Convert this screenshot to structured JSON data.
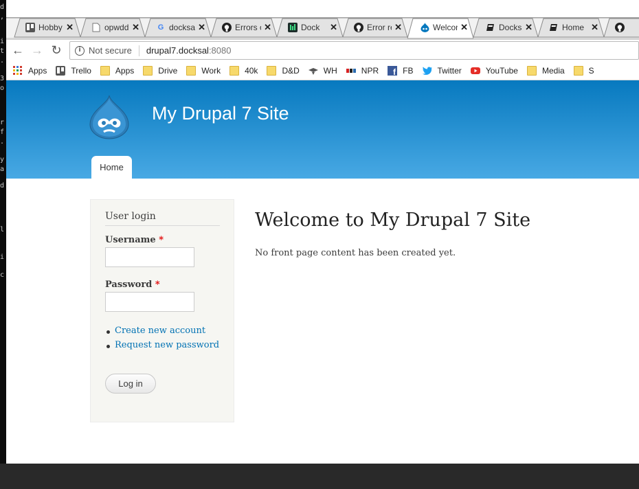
{
  "terminal_strip": [
    "d",
    ",",
    "i",
    "t",
    ".",
    "3",
    "o",
    "r",
    "f",
    ".",
    "y",
    "a",
    "d",
    "l",
    "i",
    "c"
  ],
  "tabs": [
    {
      "label": "Hobby",
      "icon": "trello-icon"
    },
    {
      "label": "opwdd",
      "icon": "page-icon"
    },
    {
      "label": "docksal",
      "icon": "google-icon"
    },
    {
      "label": "Errors o",
      "icon": "github-icon"
    },
    {
      "label": "Dock",
      "icon": "docker-icon"
    },
    {
      "label": "Error re",
      "icon": "github-icon"
    },
    {
      "label": "Welcom",
      "icon": "drupal-icon",
      "active": true
    },
    {
      "label": "Docksa",
      "icon": "book-icon"
    },
    {
      "label": "Home",
      "icon": "book-icon"
    },
    {
      "label": "",
      "icon": "github-icon"
    }
  ],
  "toolbar": {
    "security_label": "Not secure",
    "url_host": "drupal7.docksal",
    "url_port": ":8080"
  },
  "bookmarks": [
    {
      "label": "Apps",
      "icon": "apps-grid-icon"
    },
    {
      "label": "Trello",
      "icon": "trello-icon"
    },
    {
      "label": "Apps",
      "icon": "folder-icon"
    },
    {
      "label": "Drive",
      "icon": "folder-icon"
    },
    {
      "label": "Work",
      "icon": "folder-icon"
    },
    {
      "label": "40k",
      "icon": "folder-icon"
    },
    {
      "label": "D&D",
      "icon": "folder-icon"
    },
    {
      "label": "WH",
      "icon": "wh-icon"
    },
    {
      "label": "NPR",
      "icon": "npr-icon"
    },
    {
      "label": "FB",
      "icon": "facebook-icon"
    },
    {
      "label": "Twitter",
      "icon": "twitter-icon"
    },
    {
      "label": "YouTube",
      "icon": "youtube-icon"
    },
    {
      "label": "Media",
      "icon": "folder-icon"
    },
    {
      "label": "S",
      "icon": "folder-icon"
    }
  ],
  "site": {
    "name": "My Drupal 7 Site",
    "menu": [
      "Home"
    ]
  },
  "login_block": {
    "title": "User login",
    "username_label": "Username",
    "password_label": "Password",
    "required_mark": "*",
    "links": [
      "Create new account",
      "Request new password"
    ],
    "submit_label": "Log in"
  },
  "main": {
    "title": "Welcome to My Drupal 7 Site",
    "text": "No front page content has been created yet."
  },
  "colors": {
    "header_top": "#0779bf",
    "header_bottom": "#48a9e4",
    "link": "#0071b3",
    "required": "#e10000",
    "sidebar_bg": "#f6f6f2",
    "footer": "#292929"
  }
}
